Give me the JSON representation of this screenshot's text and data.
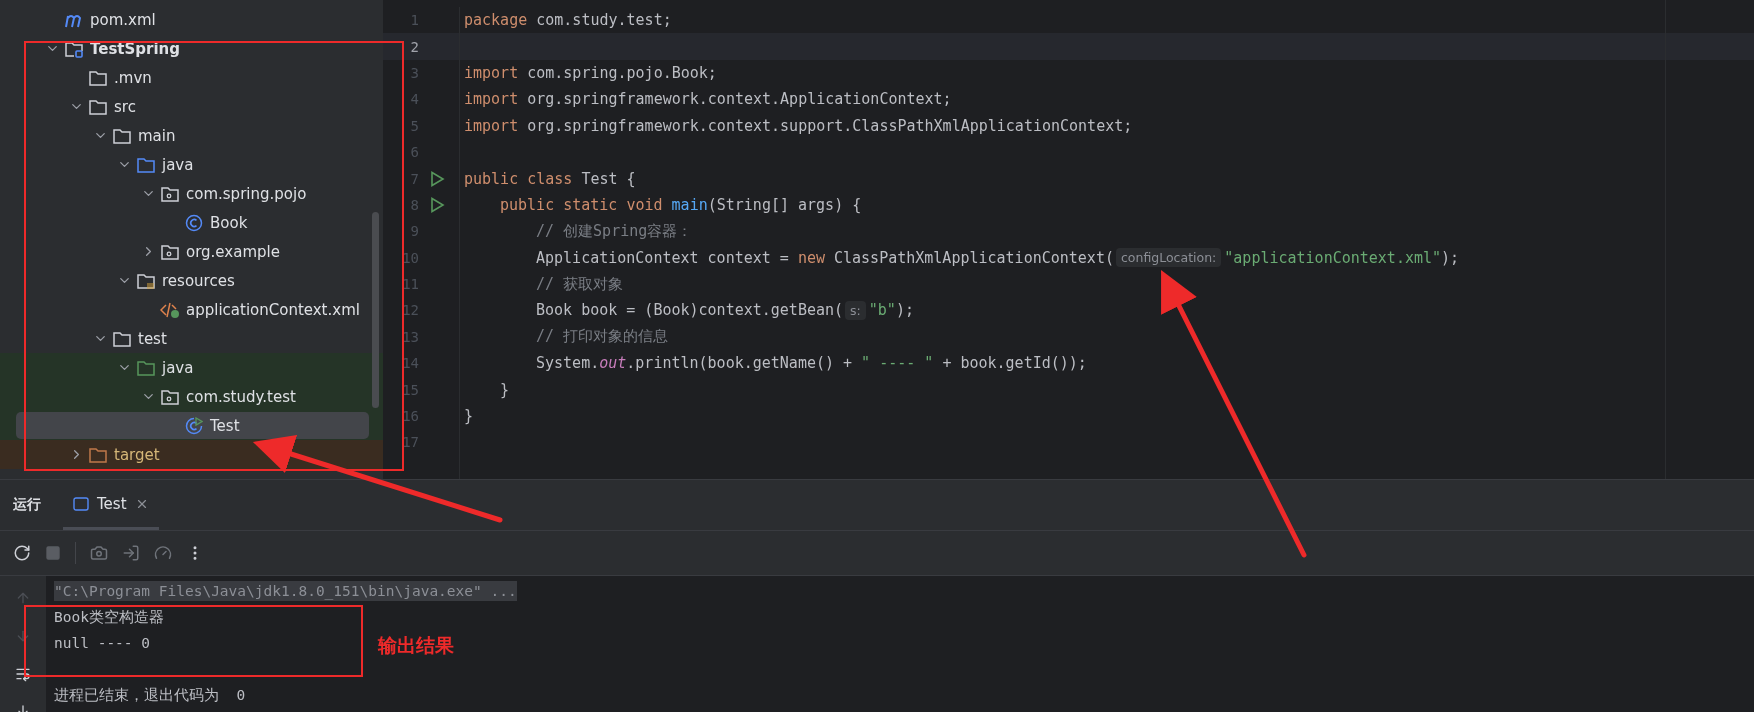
{
  "project_tree": [
    {
      "label": "pom.xml",
      "kind": "maven",
      "selected": false
    },
    {
      "label": "TestSpring",
      "kind": "module",
      "expanded": true,
      "selected": false,
      "children": [
        {
          "label": ".mvn",
          "kind": "folder",
          "selected": false
        },
        {
          "label": "src",
          "kind": "folder",
          "expanded": true,
          "selected": false,
          "children": [
            {
              "label": "main",
              "kind": "folder",
              "expanded": true,
              "selected": false,
              "children": [
                {
                  "label": "java",
                  "kind": "source",
                  "expanded": true,
                  "selected": false,
                  "children": [
                    {
                      "label": "com.spring.pojo",
                      "kind": "package",
                      "expanded": true,
                      "selected": false,
                      "children": [
                        {
                          "label": "Book",
                          "kind": "class",
                          "selected": false
                        }
                      ]
                    },
                    {
                      "label": "org.example",
                      "kind": "package",
                      "expanded": false,
                      "selected": false
                    }
                  ]
                },
                {
                  "label": "resources",
                  "kind": "resources",
                  "expanded": true,
                  "selected": false,
                  "children": [
                    {
                      "label": "applicationContext.xml",
                      "kind": "xml",
                      "selected": false
                    }
                  ]
                }
              ]
            },
            {
              "label": "test",
              "kind": "folder",
              "expanded": true,
              "selected": false,
              "children": [
                {
                  "label": "java",
                  "kind": "test-source",
                  "expanded": true,
                  "selected": false,
                  "children": [
                    {
                      "label": "com.study.test",
                      "kind": "package",
                      "expanded": true,
                      "selected": false,
                      "children": [
                        {
                          "label": "Test",
                          "kind": "runnable-class",
                          "selected": true
                        }
                      ]
                    }
                  ]
                }
              ]
            }
          ]
        },
        {
          "label": "target",
          "kind": "excluded",
          "expanded": false,
          "selected": false
        }
      ]
    }
  ],
  "editor": {
    "lines": [
      {
        "number": "1",
        "current": false,
        "runnable": false,
        "tokens": [
          {
            "kind": "keyword",
            "text": "package"
          },
          {
            "kind": "plain",
            "text": "com.study.test;",
            "spaced": true
          }
        ]
      },
      {
        "number": "2",
        "current": true,
        "runnable": false
      },
      {
        "number": "3",
        "current": false,
        "runnable": false,
        "tokens": [
          {
            "kind": "keyword",
            "text": "import"
          },
          {
            "kind": "plain",
            "text": "com.spring.pojo.Book;",
            "spaced": true
          }
        ]
      },
      {
        "number": "4",
        "current": false,
        "runnable": false,
        "tokens": [
          {
            "kind": "keyword",
            "text": "import"
          },
          {
            "kind": "plain",
            "text": "org.springframework.context.ApplicationContext;",
            "spaced": true
          }
        ]
      },
      {
        "number": "5",
        "current": false,
        "runnable": false,
        "tokens": [
          {
            "kind": "keyword",
            "text": "import"
          },
          {
            "kind": "plain",
            "text": "org.springframework.context.support.ClassPathXmlApplicationContext;",
            "spaced": true
          }
        ]
      },
      {
        "number": "6",
        "current": false,
        "runnable": false
      },
      {
        "number": "7",
        "current": false,
        "runnable": true,
        "tokens": [
          {
            "kind": "keyword",
            "text": "public class"
          },
          {
            "kind": "plain",
            "text": "Test {",
            "spaced": true
          }
        ],
        "children": [
          {
            "number": "8",
            "current": false,
            "runnable": true,
            "tokens": [
              {
                "kind": "keyword",
                "text": "public static void"
              },
              {
                "kind": "method",
                "text": "main",
                "spaced": true
              },
              {
                "kind": "plain",
                "text": "(String[] args) {"
              }
            ],
            "children": [
              {
                "number": "9",
                "current": false,
                "runnable": false,
                "tokens": [
                  {
                    "kind": "comment",
                    "text": "// 创建Spring容器："
                  }
                ]
              },
              {
                "number": "10",
                "current": false,
                "runnable": false,
                "tokens": [
                  {
                    "kind": "plain",
                    "text": "ApplicationContext context ="
                  },
                  {
                    "kind": "keyword",
                    "text": "new",
                    "spaced": true
                  },
                  {
                    "kind": "plain",
                    "text": "ClassPathXmlApplicationContext(",
                    "spaced": true
                  },
                  {
                    "kind": "hint",
                    "text": "configLocation:"
                  },
                  {
                    "kind": "string",
                    "text": "\"applicationContext.xml\""
                  },
                  {
                    "kind": "plain",
                    "text": ");"
                  }
                ]
              },
              {
                "number": "11",
                "current": false,
                "runnable": false,
                "tokens": [
                  {
                    "kind": "comment",
                    "text": "// 获取对象"
                  }
                ]
              },
              {
                "number": "12",
                "current": false,
                "runnable": false,
                "tokens": [
                  {
                    "kind": "plain",
                    "text": "Book book = (Book)context.getBean("
                  },
                  {
                    "kind": "hint",
                    "text": "s:"
                  },
                  {
                    "kind": "string",
                    "text": "\"b\""
                  },
                  {
                    "kind": "plain",
                    "text": ");"
                  }
                ]
              },
              {
                "number": "13",
                "current": false,
                "runnable": false,
                "tokens": [
                  {
                    "kind": "comment",
                    "text": "// 打印对象的信息"
                  }
                ]
              },
              {
                "number": "14",
                "current": false,
                "runnable": false,
                "tokens": [
                  {
                    "kind": "plain",
                    "text": "System."
                  },
                  {
                    "kind": "static",
                    "text": "out"
                  },
                  {
                    "kind": "plain",
                    "text": ".println(book.getName() +"
                  },
                  {
                    "kind": "string",
                    "text": "\" ---- \"",
                    "spaced": true
                  },
                  {
                    "kind": "plain",
                    "text": "+ book.getId());",
                    "spaced": true
                  }
                ]
              }
            ]
          },
          {
            "number": "15",
            "current": false,
            "runnable": false,
            "tokens": [
              {
                "kind": "plain",
                "text": "}"
              }
            ]
          }
        ]
      },
      {
        "number": "16",
        "current": false,
        "runnable": false,
        "tokens": [
          {
            "kind": "plain",
            "text": "}"
          }
        ]
      },
      {
        "number": "17",
        "current": false,
        "runnable": false
      }
    ]
  },
  "run_panel": {
    "title": "运行",
    "tabs": [
      {
        "label": "Test",
        "selected": true
      }
    ],
    "console": [
      {
        "kind": "command",
        "text": "\"C:\\Program Files\\Java\\jdk1.8.0_151\\bin\\java.exe\" ..."
      },
      {
        "kind": "output",
        "text": "Book类空构造器"
      },
      {
        "kind": "output",
        "text": "null ---- 0"
      },
      {
        "kind": "output",
        "text": "进程已结束，退出代码为  0",
        "gap_before": true
      }
    ]
  },
  "annotation": {
    "label": "输出结果"
  }
}
